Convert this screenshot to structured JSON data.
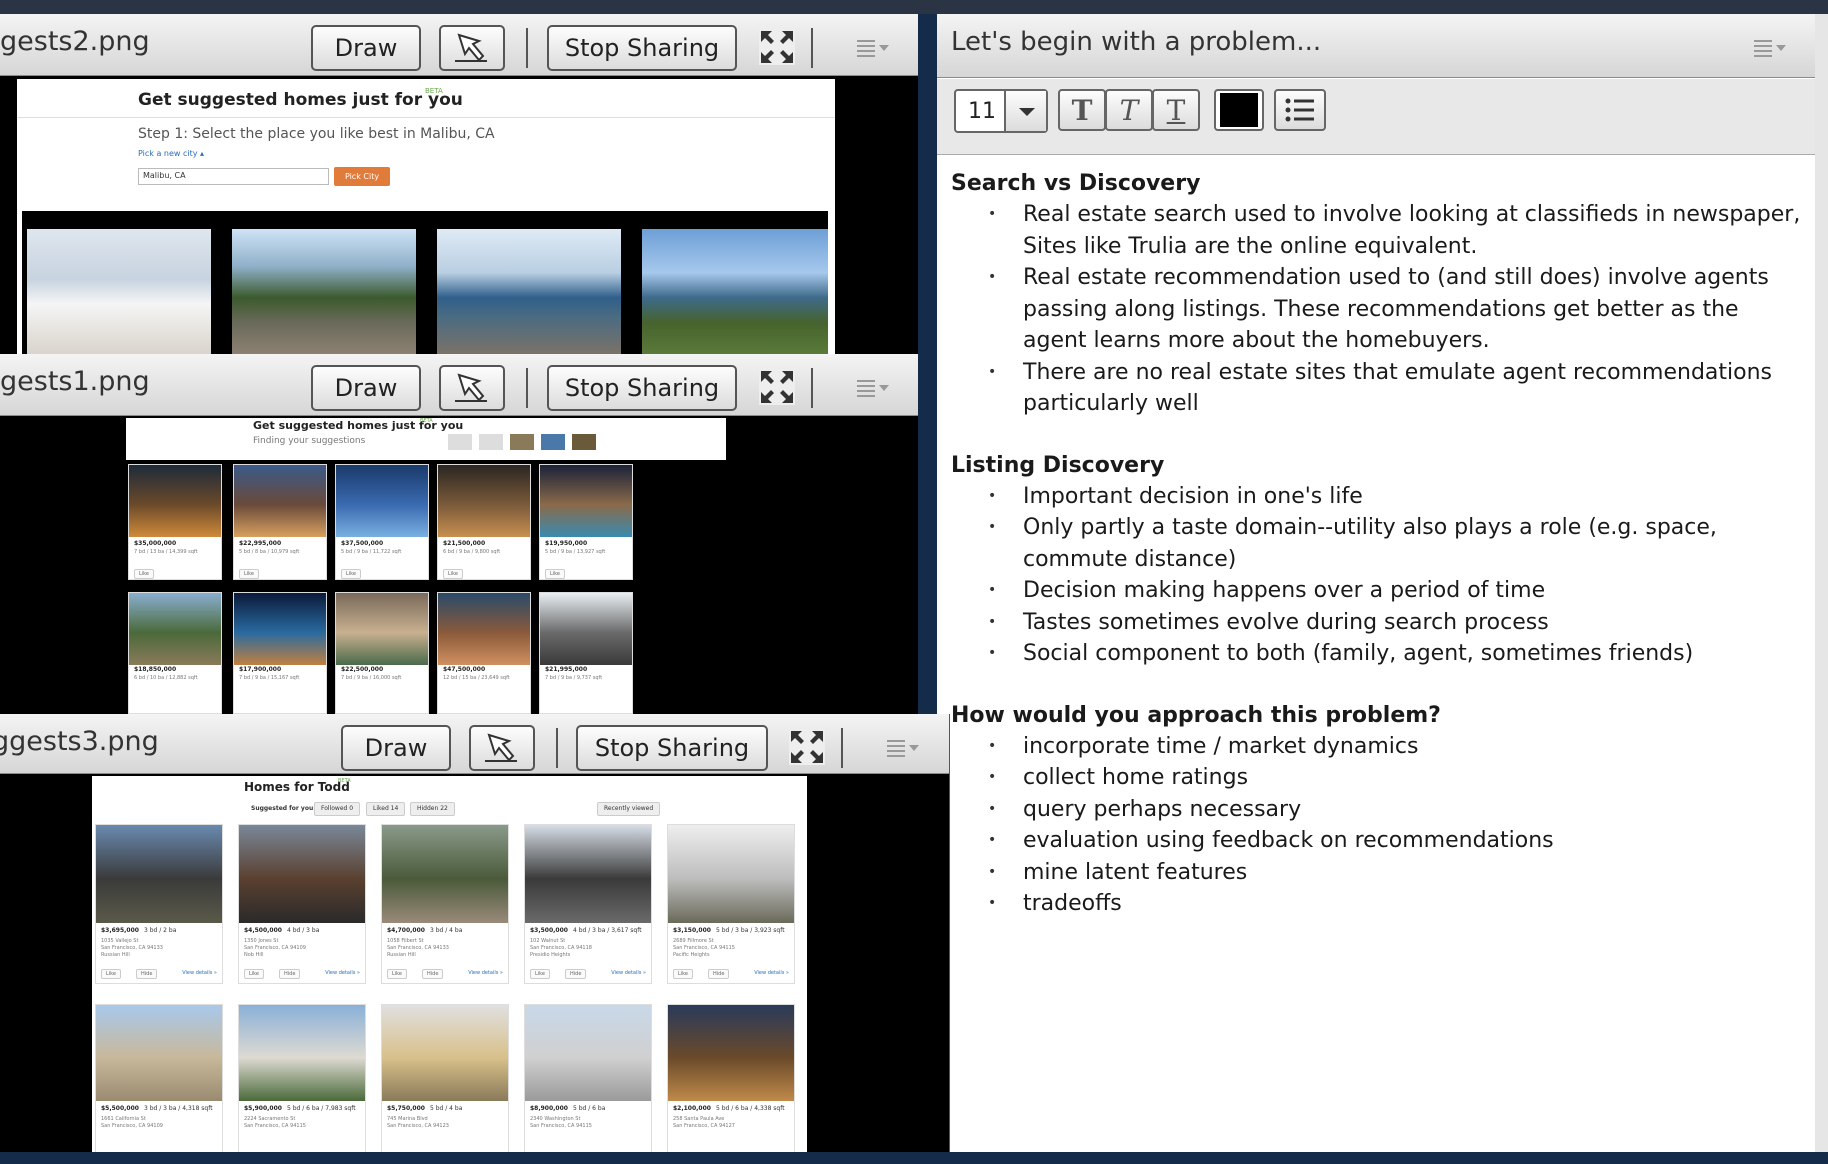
{
  "pods": {
    "pod1": {
      "title": "gests2.png",
      "draw": "Draw",
      "stop": "Stop Sharing"
    },
    "pod2": {
      "title": "gests1.png",
      "draw": "Draw",
      "stop": "Stop Sharing"
    },
    "pod3": {
      "title": "ggests3.png",
      "draw": "Draw",
      "stop": "Stop Sharing"
    }
  },
  "shot1": {
    "heading": "Get suggested homes just for you",
    "beta": "BETA",
    "step": "Step 1: Select the place you like best in Malibu, CA",
    "pick_link": "Pick a new city ▴",
    "input_value": "Malibu, CA",
    "pick_btn": "Pick City"
  },
  "shot2": {
    "heading": "Get suggested homes just for you",
    "beta": "BETA",
    "sub": "Finding your suggestions",
    "row1": [
      {
        "price": "$35,000,000",
        "meta": "7 bd / 13 ba / 14,399 sqft",
        "like": "Like"
      },
      {
        "price": "$22,995,000",
        "meta": "5 bd / 8 ba / 10,979 sqft",
        "like": "Like"
      },
      {
        "price": "$37,500,000",
        "meta": "5 bd / 9 ba / 11,722 sqft",
        "like": "Like"
      },
      {
        "price": "$21,500,000",
        "meta": "6 bd / 9 ba / 9,800 sqft",
        "like": "Like"
      },
      {
        "price": "$19,950,000",
        "meta": "5 bd / 9 ba / 13,927 sqft",
        "like": "Like"
      }
    ],
    "row2": [
      {
        "price": "$18,850,000",
        "meta": "6 bd / 10 ba / 12,882 sqft"
      },
      {
        "price": "$17,900,000",
        "meta": "7 bd / 9 ba / 15,167 sqft"
      },
      {
        "price": "$22,500,000",
        "meta": "7 bd / 9 ba / 16,000 sqft"
      },
      {
        "price": "$47,500,000",
        "meta": "12 bd / 15 ba / 23,649 sqft"
      },
      {
        "price": "$21,995,000",
        "meta": "7 bd / 9 ba / 9,737 sqft"
      }
    ]
  },
  "shot3": {
    "heading": "Homes for Todd",
    "beta": "BETA",
    "tabs": [
      "Suggested for you",
      "Followed 0",
      "Liked 14",
      "Hidden 22"
    ],
    "recent": "Recently viewed",
    "row1": [
      {
        "price": "$3,695,000",
        "meta": "3 bd / 2 ba",
        "addr1": "1035 Vallejo St",
        "addr2": "San Francisco, CA 94133",
        "hood": "Russian Hill",
        "like": "Like",
        "hide": "Hide",
        "view": "View details »"
      },
      {
        "price": "$4,500,000",
        "meta": "4 bd / 3 ba",
        "addr1": "1350 Jones St",
        "addr2": "San Francisco, CA 94109",
        "hood": "Nob Hill",
        "like": "Like",
        "hide": "Hide",
        "view": "View details »"
      },
      {
        "price": "$4,700,000",
        "meta": "3 bd / 4 ba",
        "addr1": "1058 Filbert St",
        "addr2": "San Francisco, CA 94133",
        "hood": "Russian Hill",
        "like": "Like",
        "hide": "Hide",
        "view": "View details »"
      },
      {
        "price": "$3,500,000",
        "meta": "4 bd / 3 ba / 3,617 sqft",
        "addr1": "102 Walnut St",
        "addr2": "San Francisco, CA 94118",
        "hood": "Presidio Heights",
        "like": "Like",
        "hide": "Hide",
        "view": "View details »"
      },
      {
        "price": "$3,150,000",
        "meta": "5 bd / 3 ba / 3,923 sqft",
        "addr1": "2689 Fillmore St",
        "addr2": "San Francisco, CA 94115",
        "hood": "Pacific Heights",
        "like": "Like",
        "hide": "Hide",
        "view": "View details »"
      }
    ],
    "row2": [
      {
        "price": "$5,500,000",
        "meta": "3 bd / 3 ba / 4,318 sqft",
        "addr1": "1661 California St",
        "addr2": "San Francisco, CA 94109"
      },
      {
        "price": "$5,900,000",
        "meta": "5 bd / 6 ba / 7,983 sqft",
        "addr1": "2224 Sacramento St",
        "addr2": "San Francisco, CA 94115"
      },
      {
        "price": "$5,750,000",
        "meta": "5 bd / 4 ba",
        "addr1": "745 Marina Blvd",
        "addr2": "San Francisco, CA 94123"
      },
      {
        "price": "$8,900,000",
        "meta": "5 bd / 6 ba",
        "addr1": "2340 Washington St",
        "addr2": "San Francisco, CA 94115"
      },
      {
        "price": "$2,100,000",
        "meta": "5 bd / 6 ba / 4,338 sqft",
        "addr1": "258 Santa Paula Ave",
        "addr2": "San Francisco, CA 94127"
      }
    ]
  },
  "notes": {
    "title": "Let's begin with a problem...",
    "font_size": "11",
    "text_color": "#000000",
    "sections": [
      {
        "heading": "Search vs Discovery",
        "items": [
          "Real estate search used to involve looking at classifieds in newspaper, Sites like Trulia are the online equivalent.",
          "Real estate recommendation used to (and still does) involve agents passing along listings.  These recommendations get better as the agent learns more about the homebuyers.",
          "There are no real estate sites that emulate agent recommendations particularly well"
        ]
      },
      {
        "heading": "Listing Discovery",
        "items": [
          "Important decision in one's life",
          "Only partly a taste domain--utility also plays a role (e.g. space, commute distance)",
          "Decision making happens over a period of time",
          "Tastes sometimes evolve during search process",
          "Social component to both (family, agent, sometimes friends)"
        ]
      },
      {
        "heading": "How would you approach this problem?",
        "items": [
          "incorporate time / market dynamics",
          "collect home ratings",
          "query perhaps necessary",
          "evaluation using feedback on recommendations",
          "mine latent features",
          "tradeoffs"
        ]
      }
    ]
  },
  "colors": {
    "bg": "#142c4a",
    "pick_btn": "#e07b39",
    "link": "#2a6ebb",
    "beta": "#6aa84f"
  },
  "icons": [
    "pointer-icon",
    "fullscreen-icon",
    "pod-menu-icon",
    "bold-icon",
    "italic-icon",
    "underline-icon",
    "bullet-list-icon",
    "chevron-down-icon"
  ]
}
